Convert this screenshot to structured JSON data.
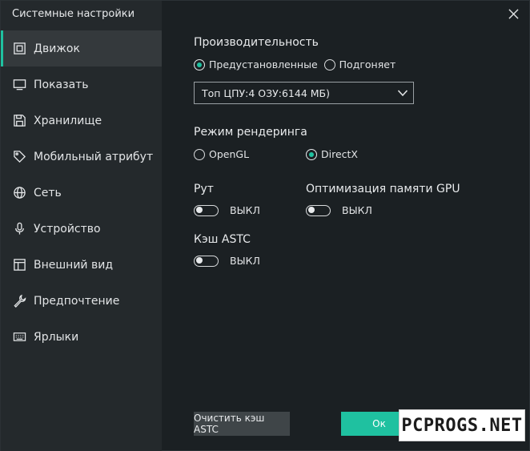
{
  "window": {
    "title": "Системные настройки"
  },
  "colors": {
    "accent": "#1fc1a0",
    "sidebar": "#24292c",
    "background": "#1b2023"
  },
  "sidebar": {
    "items": [
      {
        "label": "Движок",
        "icon": "chip-icon",
        "active": true
      },
      {
        "label": "Показать",
        "icon": "monitor-icon",
        "active": false
      },
      {
        "label": "Хранилище",
        "icon": "floppy-disk-icon",
        "active": false
      },
      {
        "label": "Мобильный атрибут",
        "icon": "tag-icon",
        "active": false
      },
      {
        "label": "Сеть",
        "icon": "globe-icon",
        "active": false
      },
      {
        "label": "Устройство",
        "icon": "microphone-icon",
        "active": false
      },
      {
        "label": "Внешний вид",
        "icon": "window-layout-icon",
        "active": false
      },
      {
        "label": "Предпочтение",
        "icon": "wrench-icon",
        "active": false
      },
      {
        "label": "Ярлыки",
        "icon": "keyboard-icon",
        "active": false
      }
    ]
  },
  "performance": {
    "label": "Производительность",
    "options": [
      {
        "label": "Предустановленные",
        "selected": true
      },
      {
        "label": "Подгоняет",
        "selected": false
      }
    ],
    "preset_value": "Топ ЦПУ:4 ОЗУ:6144 МБ)"
  },
  "render": {
    "label": "Режим рендеринга",
    "options": [
      {
        "label": "OpenGL",
        "selected": false
      },
      {
        "label": "DirectX",
        "selected": true
      }
    ]
  },
  "toggles": {
    "root": {
      "label": "Рут",
      "state": "ВЫКЛ"
    },
    "gpu": {
      "label": "Оптимизация памяти GPU",
      "state": "ВЫКЛ"
    },
    "astc": {
      "label": "Кэш ASTC",
      "state": "ВЫКЛ"
    }
  },
  "buttons": {
    "clear_astc": "Очистить кэш ASTC",
    "ok": "Ок"
  },
  "watermark": {
    "text": "PCPROGS.NET"
  }
}
